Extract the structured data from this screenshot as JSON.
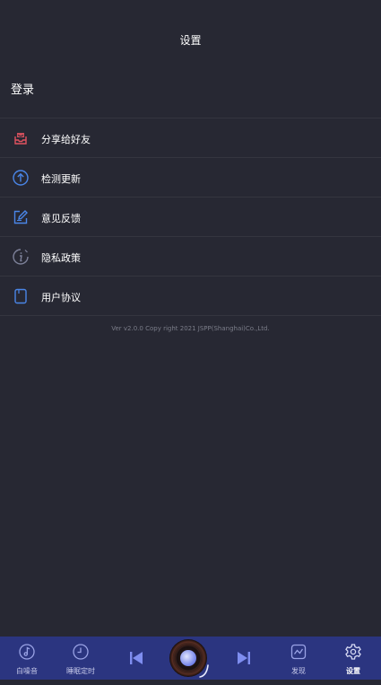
{
  "header": {
    "title": "设置"
  },
  "account": {
    "login_label": "登录"
  },
  "menu": {
    "items": [
      {
        "label": "分享给好友",
        "icon": "share-inbox-icon",
        "color": "#e0525f"
      },
      {
        "label": "检测更新",
        "icon": "upload-arrow-icon",
        "color": "#4a86e8"
      },
      {
        "label": "意见反馈",
        "icon": "edit-note-icon",
        "color": "#4a86e8"
      },
      {
        "label": "隐私政策",
        "icon": "info-icon",
        "color": "#7d8199"
      },
      {
        "label": "用户协议",
        "icon": "document-icon",
        "color": "#4a86e8"
      }
    ]
  },
  "version_text": "Ver v2.0.0 Copy right 2021 JSPP(Shanghai)Co.,Ltd.",
  "bottom_nav": {
    "background": "#2b3580",
    "tabs": [
      {
        "label": "白噪音",
        "icon": "music-note-icon"
      },
      {
        "label": "睡眠定时",
        "icon": "clock-icon"
      },
      {
        "label": "发现",
        "icon": "chart-icon"
      },
      {
        "label": "设置",
        "icon": "gear-icon",
        "active": true
      }
    ],
    "controls": {
      "previous_icon": "skip-previous-icon",
      "next_icon": "skip-next-icon",
      "player_icon": "vinyl-disc-icon"
    }
  }
}
